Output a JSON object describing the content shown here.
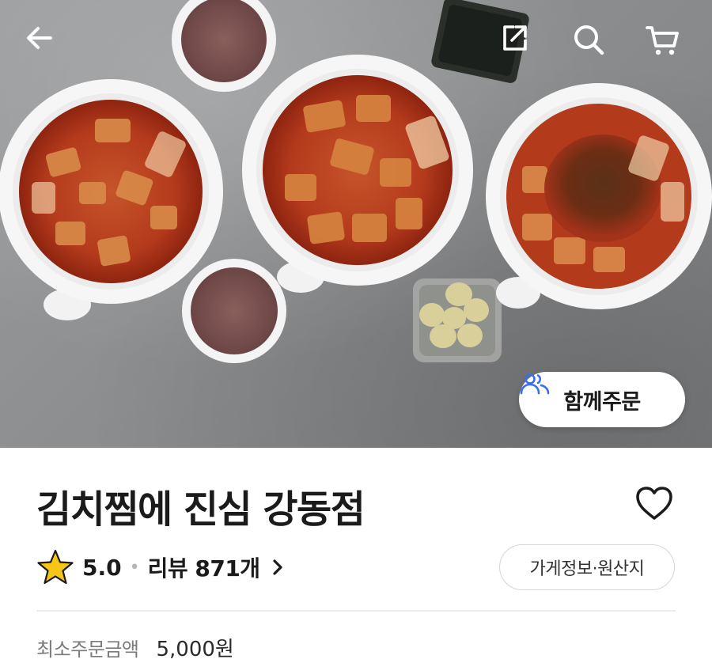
{
  "hero": {
    "image": "stew-bowls-photo",
    "together_order_label": "함께주문",
    "icons": {
      "back": "arrow-left-icon",
      "share": "share-icon",
      "search": "search-icon",
      "cart": "cart-icon",
      "together": "people-icon"
    }
  },
  "store": {
    "name": "김치찜에 진심 강동점",
    "rating": "5.0",
    "reviews_label": "리뷰 871개",
    "info_button": "가게정보·원산지",
    "min_order_label": "최소주문금액",
    "min_order_value": "5,000원"
  },
  "colors": {
    "accent_blue": "#3a6df0",
    "star": "#f5c518",
    "text": "#1b1b1b"
  }
}
